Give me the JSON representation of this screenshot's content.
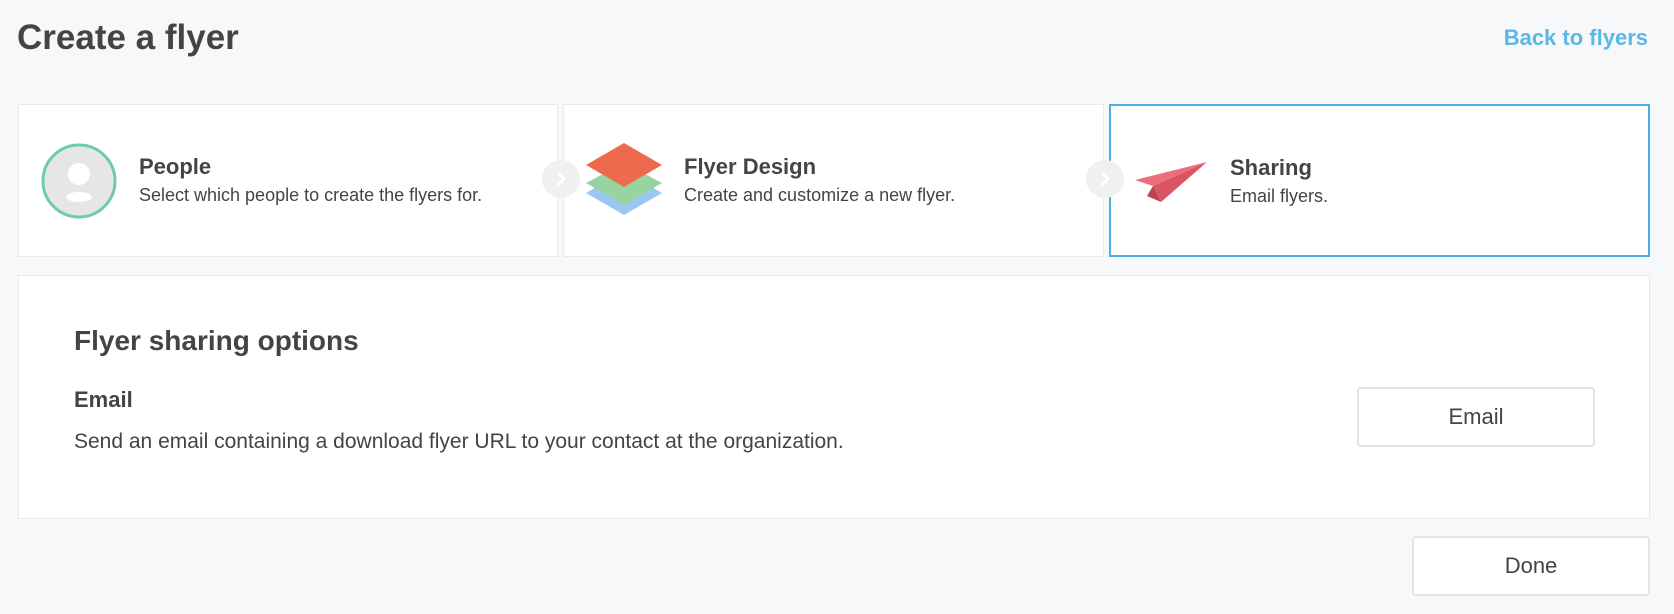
{
  "header": {
    "title": "Create a flyer",
    "back_link": "Back to flyers"
  },
  "steps": [
    {
      "title": "People",
      "description": "Select which people to create the flyers for.",
      "icon": "person-avatar-icon"
    },
    {
      "title": "Flyer Design",
      "description": "Create and customize a new flyer.",
      "icon": "layers-icon"
    },
    {
      "title": "Sharing",
      "description": "Email flyers.",
      "icon": "paper-plane-icon",
      "active": true
    }
  ],
  "sharing_panel": {
    "title": "Flyer sharing options",
    "options": [
      {
        "label": "Email",
        "description": "Send an email containing a download flyer URL to your contact at the organization.",
        "button_label": "Email"
      }
    ]
  },
  "footer": {
    "done_label": "Done"
  },
  "colors": {
    "accent": "#4ab0e4",
    "link": "#5bb8e6",
    "avatar_ring": "#6fcca8",
    "layer_top": "#ee6a4d",
    "layer_mid": "#98d3a2",
    "layer_bottom": "#9cc7f0",
    "plane": "#ec6e7a"
  }
}
